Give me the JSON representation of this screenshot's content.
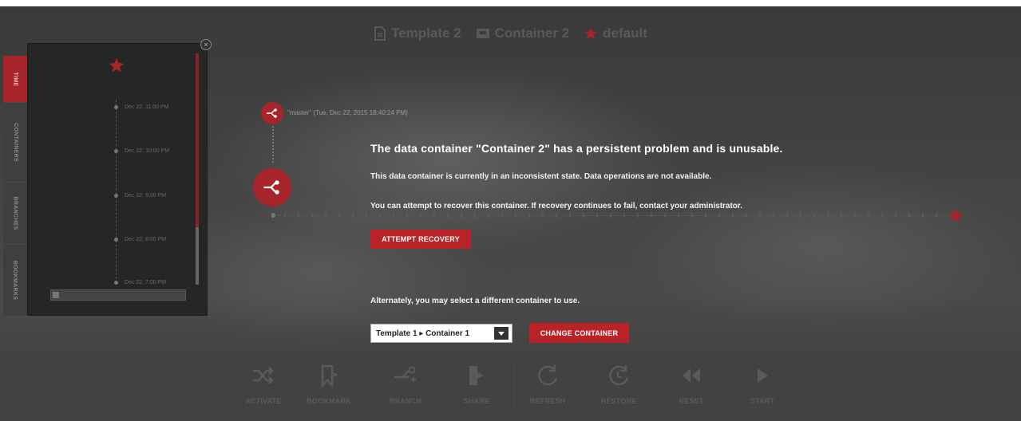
{
  "header": {
    "template_label": "Template 2",
    "container_label": "Container 2",
    "branch_label": "default"
  },
  "sidebar": {
    "tabs": [
      {
        "label": "TIME",
        "active": true
      },
      {
        "label": "CONTAINERS",
        "active": false
      },
      {
        "label": "BRANCHES",
        "active": false
      },
      {
        "label": "BOOKMARKS",
        "active": false
      }
    ],
    "time_entries": [
      "Dec 22, 11:00 PM",
      "Dec 22, 10:00 PM",
      "Dec 22, 9:00 PM",
      "Dec 22, 8:00 PM",
      "Dec 22, 7:00 PM"
    ]
  },
  "timeline": {
    "master_label": "\"master\" (Tue, Dec 22, 2015 18:40:24 PM)"
  },
  "message": {
    "title": "The data container \"Container 2\" has a persistent problem and is unusable.",
    "line1": "This data container is currently in an inconsistent state. Data operations are not available.",
    "line2": "You can attempt to recover this container. If recovery continues to fail, contact your administrator.",
    "recovery_button": "ATTEMPT RECOVERY",
    "alt_text": "Alternately, you may select a different container to use.",
    "select_value": "Template 1 ▸ Container 1",
    "change_button": "CHANGE CONTAINER"
  },
  "toolbar": {
    "items": [
      "ACTIVATE",
      "BOOKMARK",
      "BRANCH",
      "SHARE",
      "REFRESH",
      "RESTORE",
      "RESET",
      "START"
    ]
  },
  "colors": {
    "accent": "#b92328",
    "background": "#3a3a3a",
    "toolbar": "#424242"
  }
}
